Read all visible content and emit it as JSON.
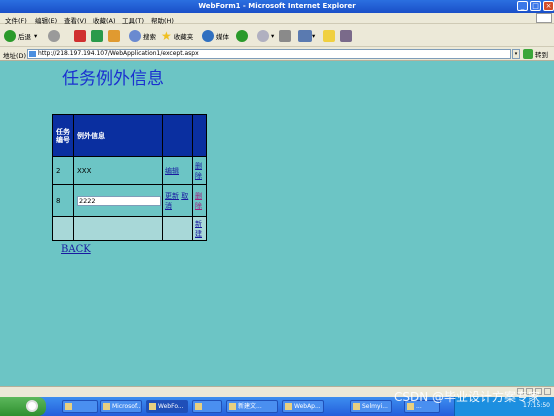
{
  "window": {
    "title": "WebForm1 - Microsoft Internet Explorer"
  },
  "menu": [
    "文件(F)",
    "编辑(E)",
    "查看(V)",
    "收藏(A)",
    "工具(T)",
    "帮助(H)"
  ],
  "toolbar": {
    "back": "后退",
    "search": "搜索",
    "favorites": "收藏夹",
    "media": "媒体"
  },
  "address": {
    "label": "地址(D)",
    "url": "http://218.197.194.107/WebApplication1/except.aspx",
    "go": "转到"
  },
  "page": {
    "title": "任务例外信息",
    "grid": {
      "header": {
        "id": "任务编号",
        "info": "例外信息"
      },
      "rows": [
        {
          "id": "2",
          "info": "XXX",
          "edit": "编辑",
          "del": "删除"
        },
        {
          "id": "8",
          "input": "2222",
          "update": "更新",
          "cancel": "取消",
          "del": "删除"
        }
      ],
      "new": "新建"
    },
    "back": "BACK"
  },
  "taskbar": {
    "tasks": [
      "Microsof...",
      "WebFo...",
      "新建文...",
      "WebAp...",
      "Selmyi...",
      "..."
    ],
    "clock": "17:15:50"
  },
  "watermark": "CSDN @毕业设计方案专家"
}
